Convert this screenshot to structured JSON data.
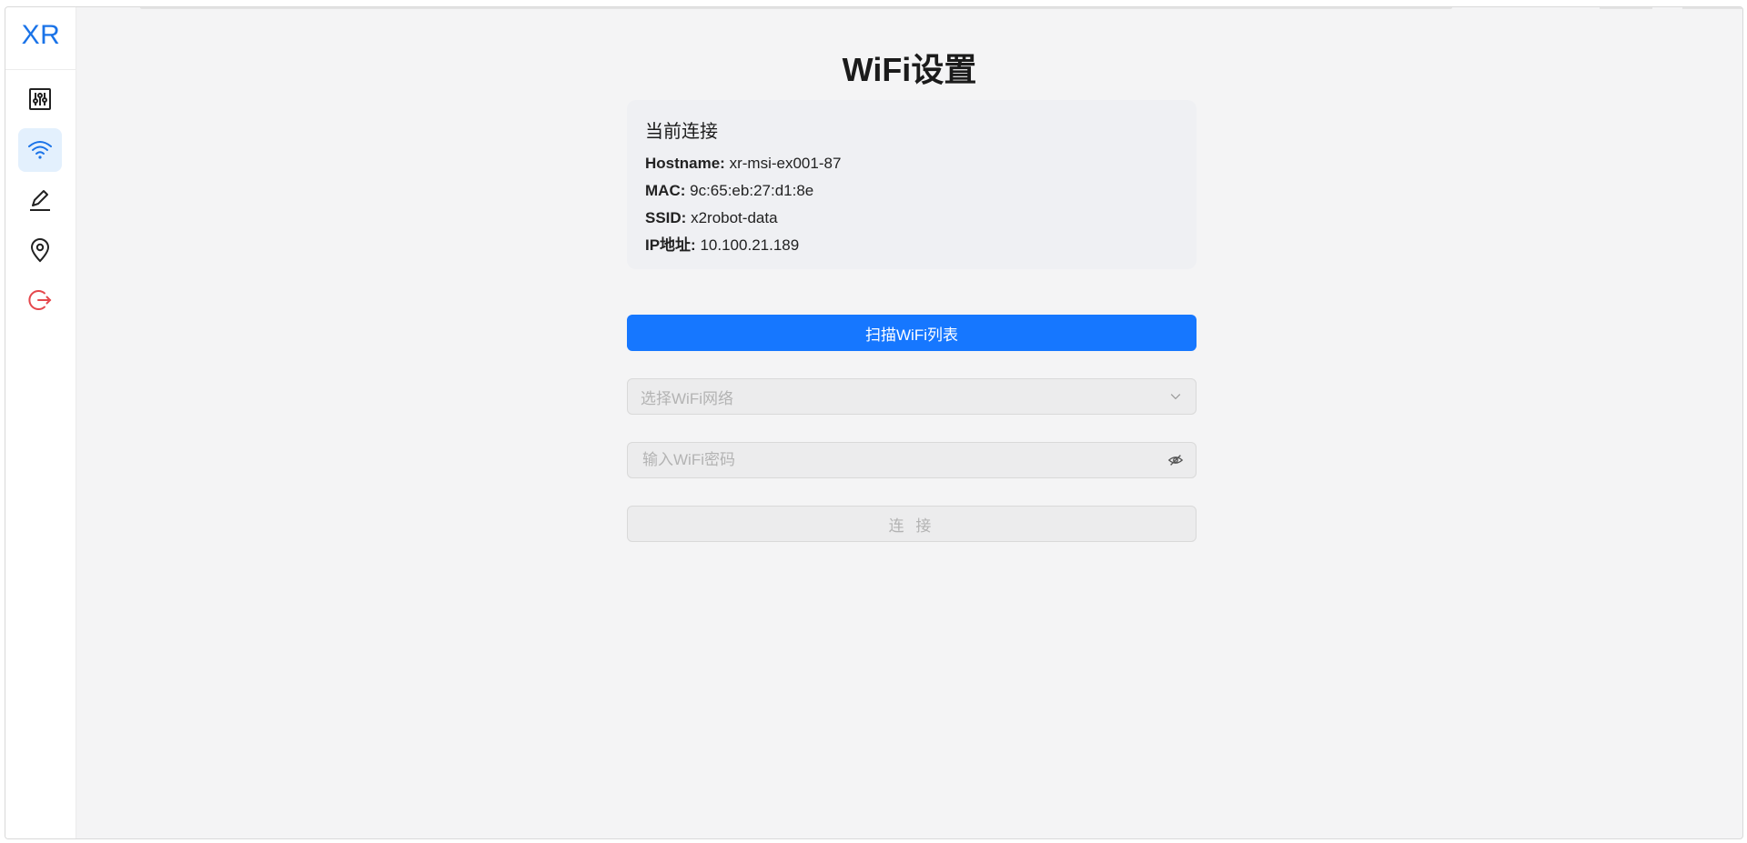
{
  "sidebar": {
    "logo": "XR",
    "items": [
      {
        "name": "settings",
        "icon": "sliders-icon"
      },
      {
        "name": "wifi",
        "icon": "wifi-icon",
        "active": true
      },
      {
        "name": "edit",
        "icon": "pen-icon"
      },
      {
        "name": "location",
        "icon": "map-pin-icon"
      },
      {
        "name": "logout",
        "icon": "logout-icon"
      }
    ]
  },
  "page": {
    "title": "WiFi设置"
  },
  "current_connection": {
    "title": "当前连接",
    "rows": [
      {
        "key": "Hostname:",
        "value": "xr-msi-ex001-87"
      },
      {
        "key": "MAC:",
        "value": "9c:65:eb:27:d1:8e"
      },
      {
        "key": "SSID:",
        "value": "x2robot-data"
      },
      {
        "key": "IP地址:",
        "value": "10.100.21.189"
      }
    ]
  },
  "actions": {
    "scan_label": "扫描WiFi列表",
    "select_placeholder": "选择WiFi网络",
    "password_placeholder": "输入WiFi密码",
    "connect_label": "连 接"
  },
  "colors": {
    "accent": "#1677ff",
    "logo": "#1a73e8",
    "logout": "#e5484d",
    "active_nav_bg": "#e3f0fd"
  }
}
